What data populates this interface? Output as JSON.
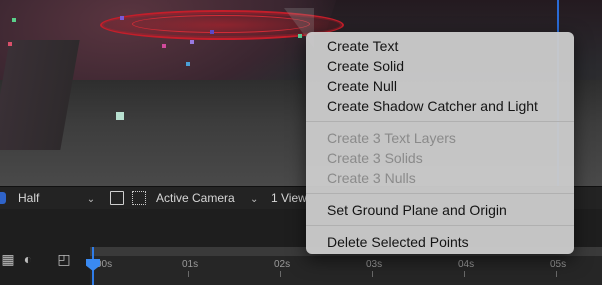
{
  "viewer": {
    "resolution": "Half",
    "view_mode": "Active Camera",
    "view_count": "1 View"
  },
  "timeline": {
    "ticks": [
      "00s",
      "01s",
      "02s",
      "03s",
      "04s",
      "05s"
    ]
  },
  "context_menu": {
    "group1": [
      "Create Text",
      "Create Solid",
      "Create Null",
      "Create Shadow Catcher and Light"
    ],
    "group2": [
      "Create 3 Text Layers",
      "Create 3 Solids",
      "Create 3 Nulls"
    ],
    "group3": [
      "Set Ground Plane and Origin"
    ],
    "group4": [
      "Delete Selected Points"
    ]
  },
  "colors": {
    "accent_blue": "#2f7ce8",
    "ellipse_red": "#c41e2a",
    "menu_bg": "#cbcbcb"
  }
}
